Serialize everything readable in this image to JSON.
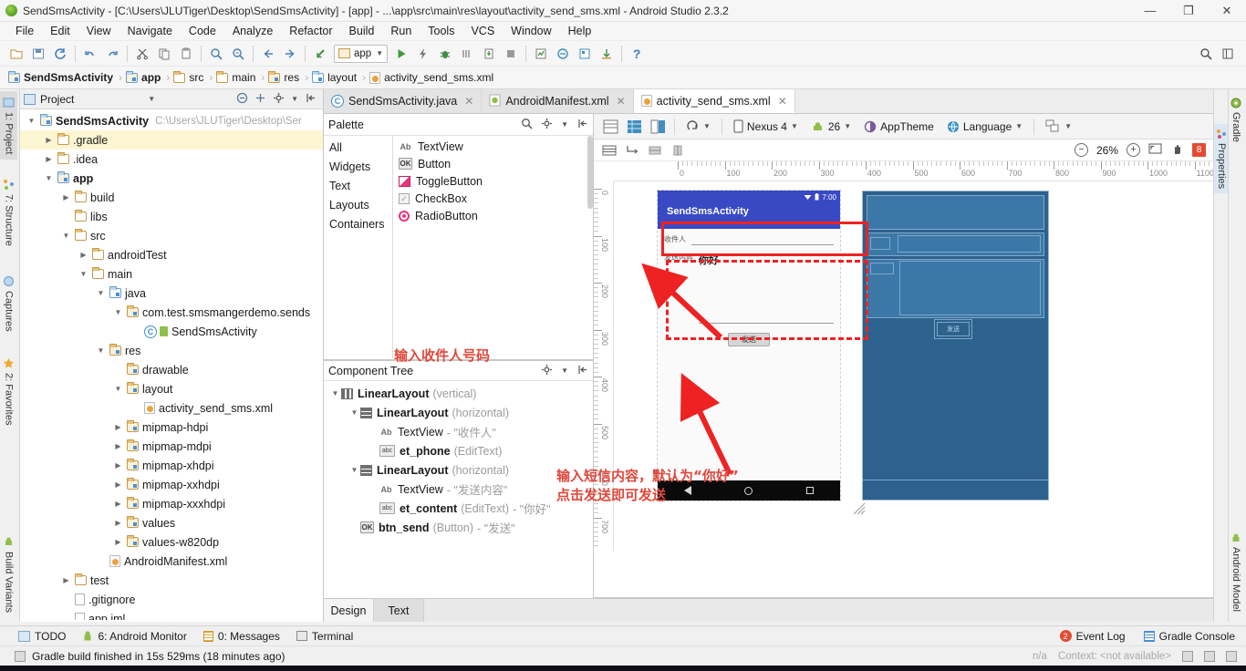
{
  "window": {
    "title": "SendSmsActivity - [C:\\Users\\JLUTiger\\Desktop\\SendSmsActivity] - [app] - ...\\app\\src\\main\\res\\layout\\activity_send_sms.xml - Android Studio 2.3.2",
    "minimize": "—",
    "maximize": "❐",
    "close": "✕"
  },
  "menu": {
    "items": [
      "File",
      "Edit",
      "View",
      "Navigate",
      "Code",
      "Analyze",
      "Refactor",
      "Build",
      "Run",
      "Tools",
      "VCS",
      "Window",
      "Help"
    ]
  },
  "toolbar": {
    "run_config": "app",
    "help_label": "?",
    "icons": [
      "open-icon",
      "save-all-icon",
      "sync-icon",
      "undo-icon",
      "redo-icon",
      "cut-icon",
      "copy-icon",
      "paste-icon",
      "find-icon",
      "replace-icon",
      "back-icon",
      "forward-icon",
      "backtrack-icon"
    ],
    "right_icons": [
      "search-everywhere-icon",
      "layout-icon"
    ]
  },
  "breadcrumb": {
    "items": [
      {
        "label": "SendSmsActivity",
        "icon": "module-icon"
      },
      {
        "label": "app",
        "icon": "module-icon"
      },
      {
        "label": "src",
        "icon": "folder-icon"
      },
      {
        "label": "main",
        "icon": "folder-icon"
      },
      {
        "label": "res",
        "icon": "res-folder-icon"
      },
      {
        "label": "layout",
        "icon": "layout-folder-icon"
      },
      {
        "label": "activity_send_sms.xml",
        "icon": "xml-icon"
      }
    ],
    "separator": "›"
  },
  "left_tool_tabs": [
    {
      "label": "1: Project",
      "icon": "project-icon",
      "selected": true
    },
    {
      "label": "7: Structure",
      "icon": "structure-icon",
      "selected": false
    },
    {
      "label": "Captures",
      "icon": "captures-icon",
      "selected": false
    },
    {
      "label": "2: Favorites",
      "icon": "star-icon",
      "selected": false
    },
    {
      "label": "Build Variants",
      "icon": "android-icon",
      "selected": false
    }
  ],
  "right_tool_tabs": [
    {
      "label": "Gradle",
      "icon": "gradle-icon"
    },
    {
      "label": "Android Model",
      "icon": "android-icon"
    }
  ],
  "right_tool_tabs_inner": [
    {
      "label": "Properties",
      "icon": "properties-icon"
    }
  ],
  "project_panel": {
    "title": "Project",
    "header_icons": [
      "collapse-all-icon",
      "scroll-from-source-icon",
      "gear-icon",
      "hide-icon"
    ],
    "tree": [
      {
        "indent": 0,
        "twist": "▼",
        "label": "SendSmsActivity",
        "bold": true,
        "icon": "module-icon",
        "path": "C:\\Users\\JLUTiger\\Desktop\\Ser",
        "selected": false
      },
      {
        "indent": 1,
        "twist": "▶",
        "label": ".gradle",
        "bold": false,
        "icon": "folder-icon",
        "path": "",
        "selected": true
      },
      {
        "indent": 1,
        "twist": "▶",
        "label": ".idea",
        "bold": false,
        "icon": "folder-icon",
        "path": "",
        "selected": false
      },
      {
        "indent": 1,
        "twist": "▼",
        "label": "app",
        "bold": true,
        "icon": "module-icon",
        "path": "",
        "selected": false
      },
      {
        "indent": 2,
        "twist": "▶",
        "label": "build",
        "bold": false,
        "icon": "folder-icon",
        "path": "",
        "selected": false
      },
      {
        "indent": 2,
        "twist": "",
        "label": "libs",
        "bold": false,
        "icon": "folder-icon",
        "path": "",
        "selected": false
      },
      {
        "indent": 2,
        "twist": "▼",
        "label": "src",
        "bold": false,
        "icon": "folder-icon",
        "path": "",
        "selected": false
      },
      {
        "indent": 3,
        "twist": "▶",
        "label": "androidTest",
        "bold": false,
        "icon": "folder-icon",
        "path": "",
        "selected": false
      },
      {
        "indent": 3,
        "twist": "▼",
        "label": "main",
        "bold": false,
        "icon": "folder-icon",
        "path": "",
        "selected": false
      },
      {
        "indent": 4,
        "twist": "▼",
        "label": "java",
        "bold": false,
        "icon": "source-folder-icon",
        "path": "",
        "selected": false
      },
      {
        "indent": 5,
        "twist": "▼",
        "label": "com.test.smsmangerdemo.sends",
        "bold": false,
        "icon": "package-icon",
        "path": "",
        "selected": false
      },
      {
        "indent": 6,
        "twist": "",
        "label": "SendSmsActivity",
        "bold": false,
        "icon": "class-icon",
        "path": "",
        "selected": false
      },
      {
        "indent": 4,
        "twist": "▼",
        "label": "res",
        "bold": false,
        "icon": "res-folder-icon",
        "path": "",
        "selected": false
      },
      {
        "indent": 5,
        "twist": "",
        "label": "drawable",
        "bold": false,
        "icon": "res-folder-icon",
        "path": "",
        "selected": false
      },
      {
        "indent": 5,
        "twist": "▼",
        "label": "layout",
        "bold": false,
        "icon": "res-folder-icon",
        "path": "",
        "selected": false
      },
      {
        "indent": 6,
        "twist": "",
        "label": "activity_send_sms.xml",
        "bold": false,
        "icon": "xml-icon",
        "path": "",
        "selected": false
      },
      {
        "indent": 5,
        "twist": "▶",
        "label": "mipmap-hdpi",
        "bold": false,
        "icon": "res-folder-icon",
        "path": "",
        "selected": false
      },
      {
        "indent": 5,
        "twist": "▶",
        "label": "mipmap-mdpi",
        "bold": false,
        "icon": "res-folder-icon",
        "path": "",
        "selected": false
      },
      {
        "indent": 5,
        "twist": "▶",
        "label": "mipmap-xhdpi",
        "bold": false,
        "icon": "res-folder-icon",
        "path": "",
        "selected": false
      },
      {
        "indent": 5,
        "twist": "▶",
        "label": "mipmap-xxhdpi",
        "bold": false,
        "icon": "res-folder-icon",
        "path": "",
        "selected": false
      },
      {
        "indent": 5,
        "twist": "▶",
        "label": "mipmap-xxxhdpi",
        "bold": false,
        "icon": "res-folder-icon",
        "path": "",
        "selected": false
      },
      {
        "indent": 5,
        "twist": "▶",
        "label": "values",
        "bold": false,
        "icon": "res-folder-icon",
        "path": "",
        "selected": false
      },
      {
        "indent": 5,
        "twist": "▶",
        "label": "values-w820dp",
        "bold": false,
        "icon": "res-folder-icon",
        "path": "",
        "selected": false
      },
      {
        "indent": 4,
        "twist": "",
        "label": "AndroidManifest.xml",
        "bold": false,
        "icon": "manifest-icon",
        "path": "",
        "selected": false
      },
      {
        "indent": 2,
        "twist": "▶",
        "label": "test",
        "bold": false,
        "icon": "folder-icon",
        "path": "",
        "selected": false
      },
      {
        "indent": 2,
        "twist": "",
        "label": ".gitignore",
        "bold": false,
        "icon": "text-file-icon",
        "path": "",
        "selected": false
      },
      {
        "indent": 2,
        "twist": "",
        "label": "app.iml",
        "bold": false,
        "icon": "iml-file-icon",
        "path": "",
        "selected": false
      }
    ]
  },
  "editor_tabs": [
    {
      "label": "SendSmsActivity.java",
      "icon": "class-icon",
      "active": false,
      "close": "✕"
    },
    {
      "label": "AndroidManifest.xml",
      "icon": "manifest-icon",
      "active": false,
      "close": "✕"
    },
    {
      "label": "activity_send_sms.xml",
      "icon": "xml-icon",
      "active": true,
      "close": "✕"
    }
  ],
  "palette": {
    "title": "Palette",
    "header_icons": [
      "search-icon",
      "gear-icon",
      "hide-icon"
    ],
    "categories": [
      "All",
      "Widgets",
      "Text",
      "Layouts",
      "Containers"
    ],
    "items": [
      {
        "label": "TextView",
        "icon": "textview-icon"
      },
      {
        "label": "Button",
        "icon": "button-icon"
      },
      {
        "label": "ToggleButton",
        "icon": "togglebutton-icon"
      },
      {
        "label": "CheckBox",
        "icon": "checkbox-icon"
      },
      {
        "label": "RadioButton",
        "icon": "radiobutton-icon"
      }
    ]
  },
  "component_tree": {
    "title": "Component Tree",
    "header_icons": [
      "gear-icon",
      "hide-icon"
    ],
    "nodes": [
      {
        "indent": 0,
        "twist": "▼",
        "icon": "linearlayout-vertical-icon",
        "name": "LinearLayout",
        "bold": true,
        "meta": "(vertical)",
        "value": ""
      },
      {
        "indent": 1,
        "twist": "▼",
        "icon": "linearlayout-horizontal-icon",
        "name": "LinearLayout",
        "bold": true,
        "meta": "(horizontal)",
        "value": ""
      },
      {
        "indent": 2,
        "twist": "",
        "icon": "textview-icon",
        "name": "TextView",
        "bold": false,
        "meta": "",
        "value": "- \"收件人\""
      },
      {
        "indent": 2,
        "twist": "",
        "icon": "edittext-icon",
        "name": "et_phone",
        "bold": true,
        "meta": "(EditText)",
        "value": ""
      },
      {
        "indent": 1,
        "twist": "▼",
        "icon": "linearlayout-horizontal-icon",
        "name": "LinearLayout",
        "bold": true,
        "meta": "(horizontal)",
        "value": ""
      },
      {
        "indent": 2,
        "twist": "",
        "icon": "textview-icon",
        "name": "TextView",
        "bold": false,
        "meta": "",
        "value": "- \"发送内容\""
      },
      {
        "indent": 2,
        "twist": "",
        "icon": "edittext-icon",
        "name": "et_content",
        "bold": true,
        "meta": "(EditText)",
        "value": "- \"你好\""
      },
      {
        "indent": 1,
        "twist": "",
        "icon": "button-icon",
        "name": "btn_send",
        "bold": true,
        "meta": "(Button)",
        "value": "- \"发送\""
      }
    ]
  },
  "design_toolbar": {
    "view_modes": [
      "design-mode-icon",
      "blueprint-mode-icon",
      "both-mode-icon"
    ],
    "orientation_label": "orientation-icon",
    "device": "Nexus 4",
    "api_level": "26",
    "theme": "AppTheme",
    "language": "Language",
    "variants_icon": "layout-variants-icon",
    "second_row_icons": [
      "show-constraints-icon",
      "autoconnect-icon",
      "align-icon",
      "pack-icon"
    ],
    "zoom": {
      "out": "−",
      "level": "26%",
      "in": "+",
      "fit": "fit-screen-icon",
      "pan": "pan-icon",
      "errors": "8"
    }
  },
  "rulers": {
    "horizontal": [
      "0",
      "100",
      "200",
      "300",
      "400",
      "500",
      "600",
      "700",
      "800",
      "900",
      "1000",
      "1100"
    ],
    "vertical": [
      "0",
      "100",
      "200",
      "300",
      "400",
      "500",
      "600",
      "700"
    ]
  },
  "preview": {
    "status_time": "7:00",
    "status_icons": [
      "wifi-icon",
      "battery-icon"
    ],
    "app_title": "SendSmsActivity",
    "recipient_label": "收件人",
    "recipient_value": "",
    "content_label": "发送内容",
    "content_value": "你好",
    "send_button": "发送",
    "nav_icons": [
      "back-nav-icon",
      "home-nav-icon",
      "recents-nav-icon"
    ]
  },
  "annotations": [
    {
      "text": "输入收件人号码"
    },
    {
      "text": "输入短信内容，默认为“你好”"
    },
    {
      "text": "点击发送即可发送"
    }
  ],
  "design_text_tabs": [
    {
      "label": "Design",
      "active": true
    },
    {
      "label": "Text",
      "active": false
    }
  ],
  "tool_windows": {
    "left": [
      {
        "label": "TODO",
        "icon": "todo-icon"
      },
      {
        "label": "6: Android Monitor",
        "icon": "android-icon"
      },
      {
        "label": "0: Messages",
        "icon": "messages-icon"
      },
      {
        "label": "Terminal",
        "icon": "terminal-icon"
      }
    ],
    "right": [
      {
        "label": "Event Log",
        "icon": "event-log-icon"
      },
      {
        "label": "Gradle Console",
        "icon": "gradle-console-icon"
      }
    ]
  },
  "status_bar": {
    "message": "Gradle build finished in 15s 529ms (18 minutes ago)",
    "icon": "build-icon",
    "right_na": "n/a",
    "right_context": "Context: <not available>",
    "right_icons": [
      "lock-icon",
      "android-icon",
      "notification-icon"
    ]
  },
  "colors": {
    "appbar": "#3949c4",
    "blueprint": "#2d618e",
    "annotation_red": "#e0483c",
    "box_red": "#ee2222",
    "error_badge": "#e24c33"
  }
}
